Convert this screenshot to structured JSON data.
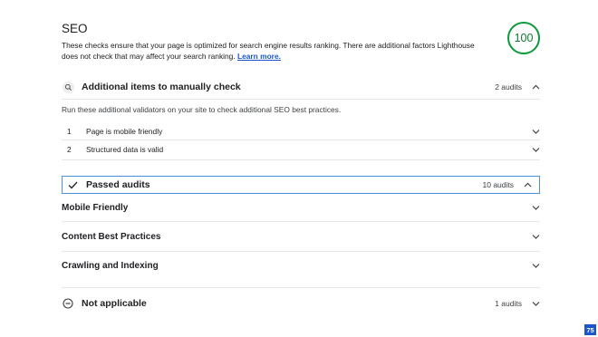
{
  "section": {
    "title": "SEO",
    "description": "These checks ensure that your page is optimized for search engine results ranking. There are additional factors Lighthouse does not check that may affect your search ranking.",
    "learn_more": "Learn more.",
    "score": "100",
    "score_color": "#0c9a3a"
  },
  "manual": {
    "icon": "search-icon",
    "title": "Additional items to manually check",
    "count": "2 audits",
    "description": "Run these additional validators on your site to check additional SEO best practices.",
    "items": [
      {
        "num": "1",
        "label": "Page is mobile friendly"
      },
      {
        "num": "2",
        "label": "Structured data is valid"
      }
    ]
  },
  "passed": {
    "icon": "check-icon",
    "title": "Passed audits",
    "count": "10 audits",
    "groups": [
      {
        "label": "Mobile Friendly"
      },
      {
        "label": "Content Best Practices"
      },
      {
        "label": "Crawling and Indexing"
      }
    ]
  },
  "not_applicable": {
    "icon": "minus-circle-icon",
    "title": "Not applicable",
    "count": "1 audits"
  },
  "page_number": "75"
}
